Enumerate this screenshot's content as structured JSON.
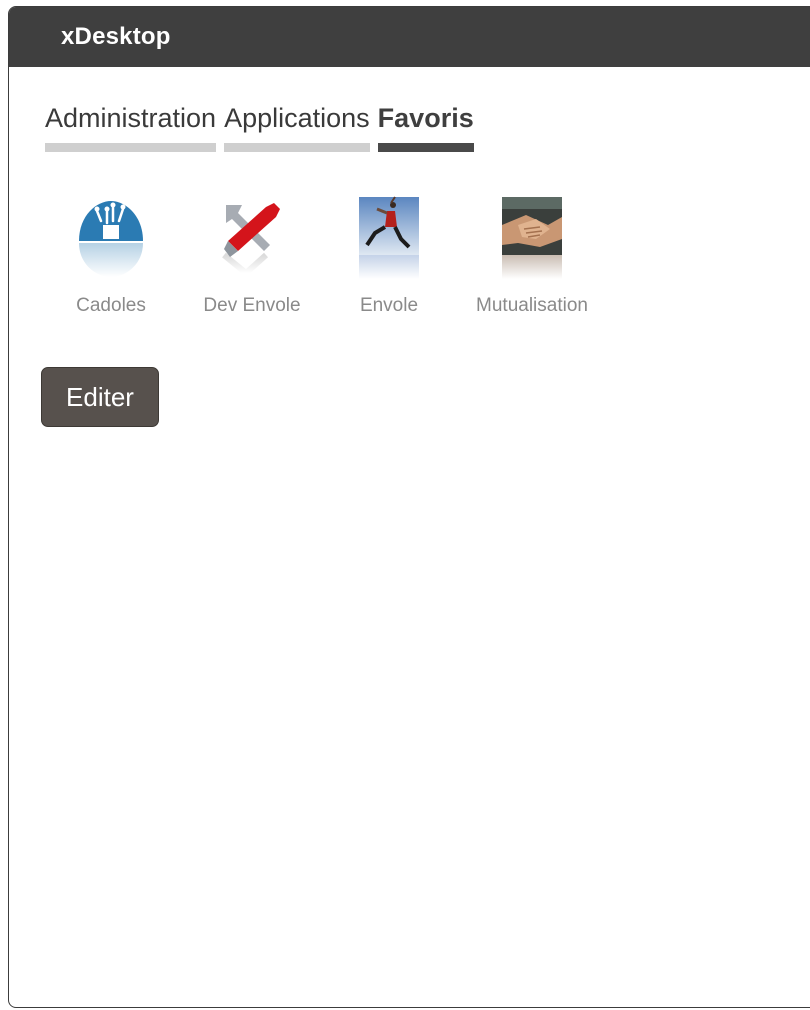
{
  "window": {
    "title": "xDesktop"
  },
  "tabs": [
    {
      "label": "Administration",
      "active": false
    },
    {
      "label": "Applications",
      "active": false
    },
    {
      "label": "Favoris",
      "active": true
    }
  ],
  "apps": [
    {
      "label": "Cadoles",
      "icon": "cadoles-dome-icon"
    },
    {
      "label": "Dev Envole",
      "icon": "wrench-screwdriver-icon"
    },
    {
      "label": "Envole",
      "icon": "leaping-person-icon"
    },
    {
      "label": "Mutualisation",
      "icon": "handshake-icon"
    }
  ],
  "actions": {
    "edit_label": "Editer"
  },
  "colors": {
    "titlebar": "#3f3f3f",
    "tab_inactive_bar": "#cfcfcf",
    "tab_active_bar": "#4a4a4a",
    "button": "#57514d",
    "cadoles_blue": "#2b7bb3",
    "devenvole_red": "#d4141b"
  }
}
